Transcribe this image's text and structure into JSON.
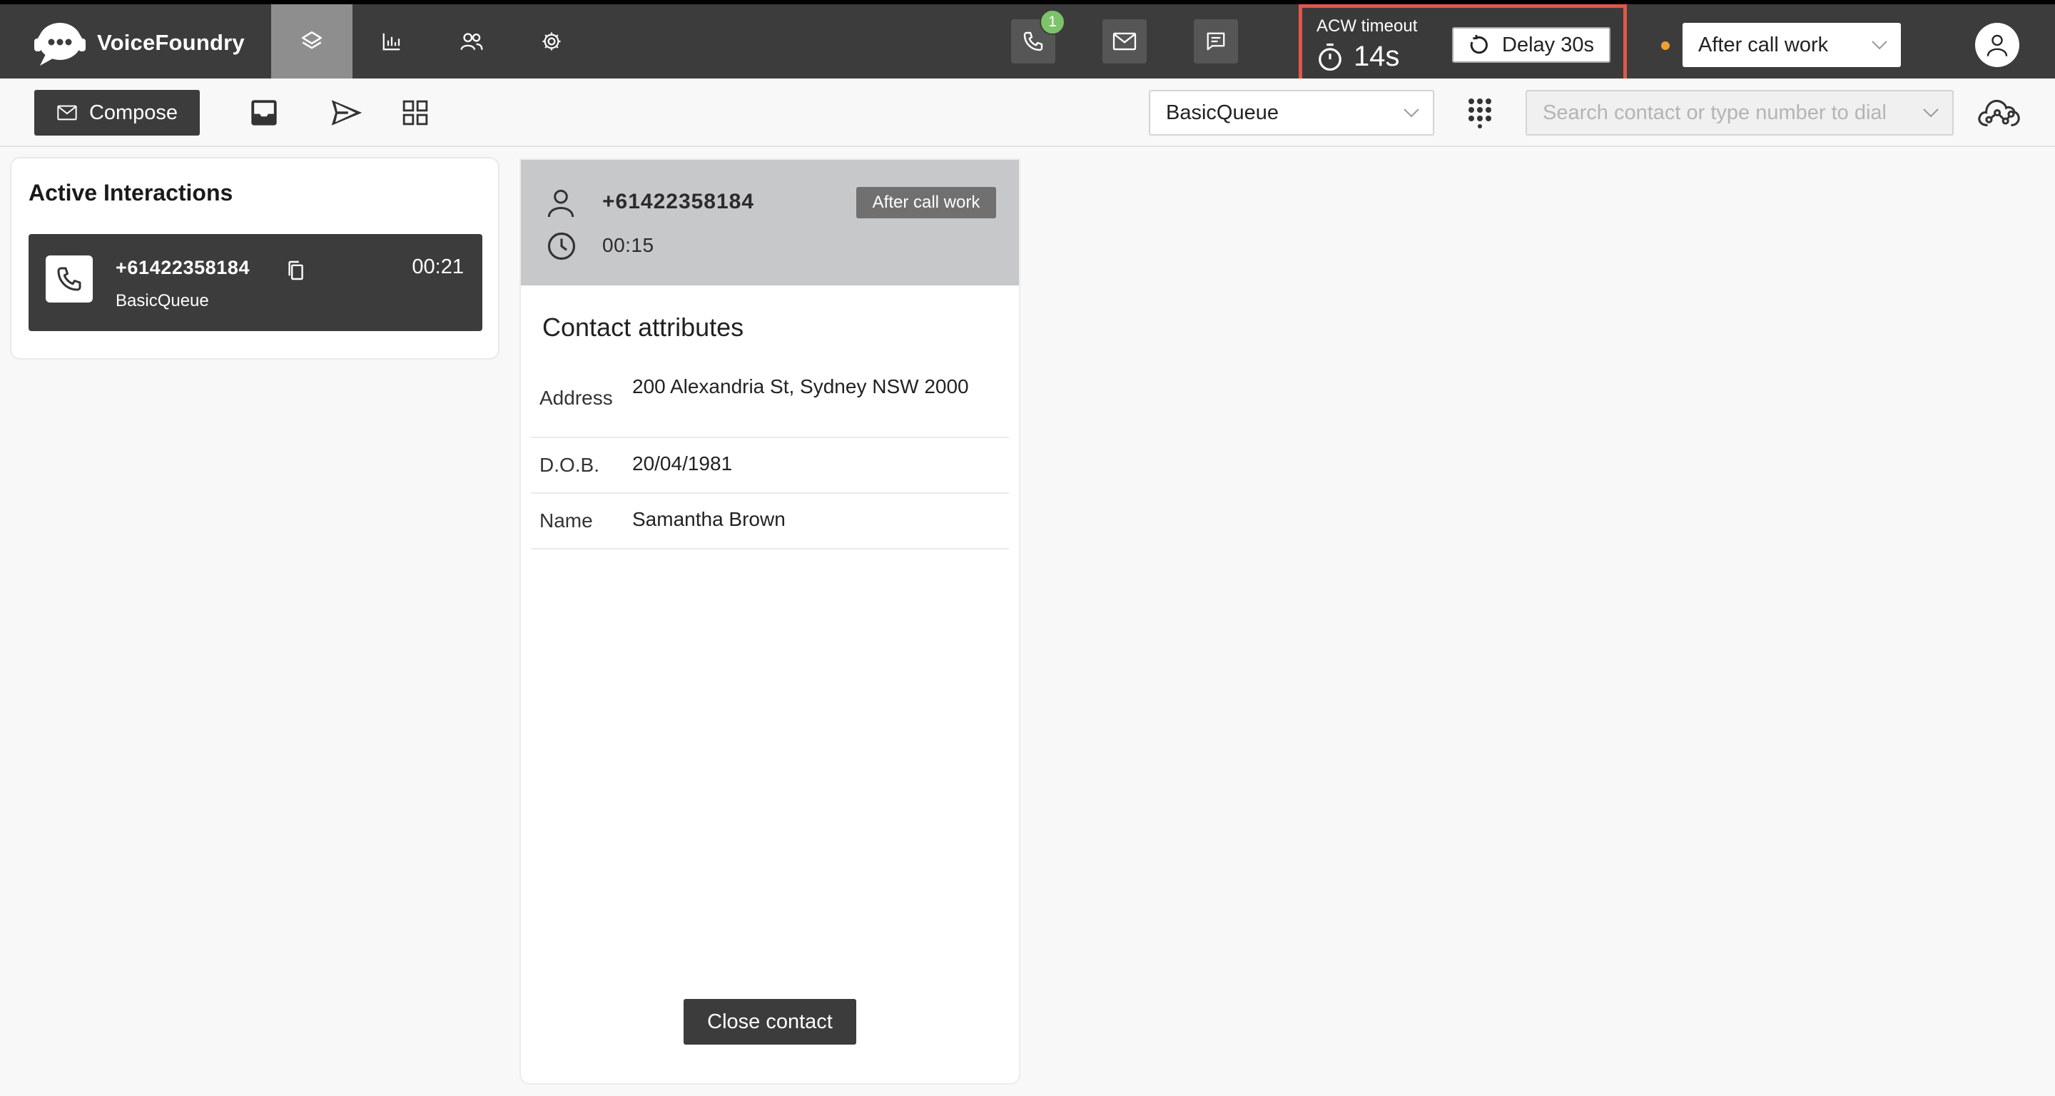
{
  "app": {
    "brand": "VoiceFoundry"
  },
  "topbar": {
    "phone_badge": "1",
    "acw": {
      "label": "ACW timeout",
      "countdown": "14s",
      "delay_label": "Delay 30s"
    },
    "status": {
      "selected": "After call work"
    }
  },
  "toolbar": {
    "compose_label": "Compose",
    "queue": {
      "selected": "BasicQueue"
    },
    "search": {
      "placeholder": "Search contact or type number to dial"
    }
  },
  "active_interactions": {
    "title": "Active Interactions",
    "items": [
      {
        "phone": "+61422358184",
        "queue": "BasicQueue",
        "time": "00:21"
      }
    ]
  },
  "contact": {
    "phone": "+61422358184",
    "state_badge": "After call work",
    "elapsed": "00:15",
    "attributes_title": "Contact attributes",
    "attributes": [
      {
        "key": "Address",
        "value": "200 Alexandria St, Sydney NSW 2000"
      },
      {
        "key": "D.O.B.",
        "value": "20/04/1981"
      },
      {
        "key": "Name",
        "value": "Samantha Brown"
      }
    ],
    "close_label": "Close contact"
  },
  "colors": {
    "topbar_bg": "#3c3c3c",
    "highlight_border": "#e0574a",
    "status_dot": "#f0a030",
    "badge_green": "#7cc36a"
  },
  "icons": {
    "logo": "chat-bubble-headset-icon",
    "nav": [
      "layers-icon",
      "bar-chart-icon",
      "users-icon",
      "gear-icon"
    ],
    "channels": [
      "phone-icon",
      "mail-icon",
      "chat-icon"
    ],
    "toolbar": [
      "mail-icon",
      "inbox-icon",
      "send-icon",
      "grid-icon",
      "dialpad-icon",
      "cloud-network-icon"
    ]
  }
}
